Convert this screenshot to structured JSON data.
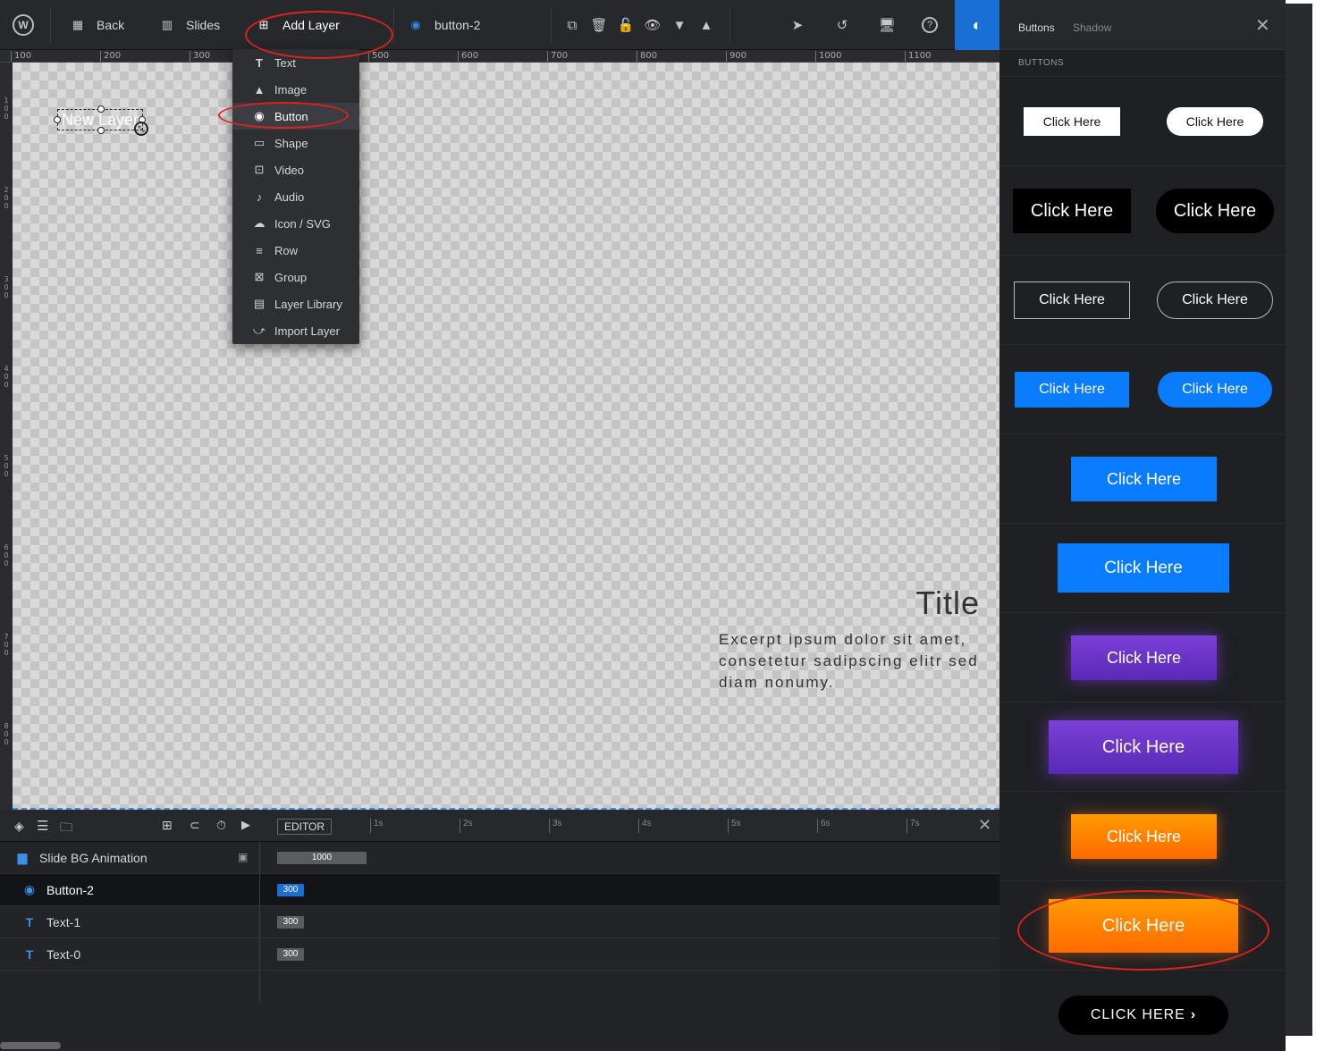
{
  "topbar": {
    "back_label": "Back",
    "slides_label": "Slides",
    "add_layer_label": "Add Layer",
    "layer_name": "button-2"
  },
  "ruler": {
    "labels": [
      "100",
      "200",
      "300",
      "500",
      "600",
      "700",
      "800",
      "900",
      "1000",
      "1100"
    ]
  },
  "canvas": {
    "new_layer_text": "New Layer",
    "title": "Title",
    "excerpt": "Excerpt ipsum dolor sit amet, consetetur sadipscing elitr sed diam nonumy."
  },
  "add_layer_menu": {
    "items": [
      {
        "label": "Text",
        "icon": "text-icon"
      },
      {
        "label": "Image",
        "icon": "image-icon"
      },
      {
        "label": "Button",
        "icon": "button-icon"
      },
      {
        "label": "Shape",
        "icon": "shape-icon"
      },
      {
        "label": "Video",
        "icon": "video-icon"
      },
      {
        "label": "Audio",
        "icon": "audio-icon"
      },
      {
        "label": "Icon / SVG",
        "icon": "cloud-icon"
      },
      {
        "label": "Row",
        "icon": "row-icon"
      },
      {
        "label": "Group",
        "icon": "group-icon"
      },
      {
        "label": "Layer Library",
        "icon": "library-icon"
      },
      {
        "label": "Import Layer",
        "icon": "import-icon"
      }
    ],
    "selected": "Button"
  },
  "timeline": {
    "editor_label": "EDITOR",
    "seconds": [
      "1s",
      "2s",
      "3s",
      "4s",
      "5s",
      "6s",
      "7s"
    ],
    "rows": [
      {
        "name": "Slide BG Animation",
        "value": "1000"
      },
      {
        "name": "Button-2",
        "value": "300"
      },
      {
        "name": "Text-1",
        "value": "300"
      },
      {
        "name": "Text-0",
        "value": "300"
      }
    ]
  },
  "panel": {
    "tab_buttons": "Buttons",
    "tab_shadow": "Shadow",
    "section_title": "BUTTONS",
    "button_label": "Click Here",
    "button_label_caps": "CLICK HERE",
    "colors": {
      "blue": "#0a7cff",
      "purple": "#6b33c9",
      "orange": "#ff7a00",
      "accent": "#1a6fd6",
      "highlight": "#d9231f"
    }
  }
}
